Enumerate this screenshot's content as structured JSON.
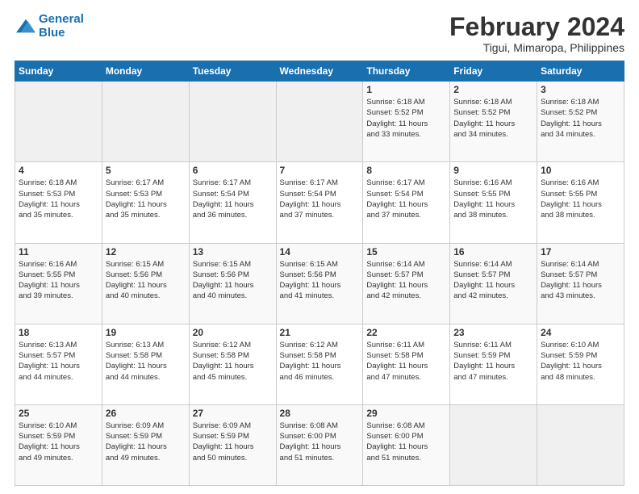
{
  "logo": {
    "line1": "General",
    "line2": "Blue"
  },
  "title": "February 2024",
  "subtitle": "Tigui, Mimaropa, Philippines",
  "days_header": [
    "Sunday",
    "Monday",
    "Tuesday",
    "Wednesday",
    "Thursday",
    "Friday",
    "Saturday"
  ],
  "weeks": [
    [
      {
        "num": "",
        "info": ""
      },
      {
        "num": "",
        "info": ""
      },
      {
        "num": "",
        "info": ""
      },
      {
        "num": "",
        "info": ""
      },
      {
        "num": "1",
        "info": "Sunrise: 6:18 AM\nSunset: 5:52 PM\nDaylight: 11 hours\nand 33 minutes."
      },
      {
        "num": "2",
        "info": "Sunrise: 6:18 AM\nSunset: 5:52 PM\nDaylight: 11 hours\nand 34 minutes."
      },
      {
        "num": "3",
        "info": "Sunrise: 6:18 AM\nSunset: 5:52 PM\nDaylight: 11 hours\nand 34 minutes."
      }
    ],
    [
      {
        "num": "4",
        "info": "Sunrise: 6:18 AM\nSunset: 5:53 PM\nDaylight: 11 hours\nand 35 minutes."
      },
      {
        "num": "5",
        "info": "Sunrise: 6:17 AM\nSunset: 5:53 PM\nDaylight: 11 hours\nand 35 minutes."
      },
      {
        "num": "6",
        "info": "Sunrise: 6:17 AM\nSunset: 5:54 PM\nDaylight: 11 hours\nand 36 minutes."
      },
      {
        "num": "7",
        "info": "Sunrise: 6:17 AM\nSunset: 5:54 PM\nDaylight: 11 hours\nand 37 minutes."
      },
      {
        "num": "8",
        "info": "Sunrise: 6:17 AM\nSunset: 5:54 PM\nDaylight: 11 hours\nand 37 minutes."
      },
      {
        "num": "9",
        "info": "Sunrise: 6:16 AM\nSunset: 5:55 PM\nDaylight: 11 hours\nand 38 minutes."
      },
      {
        "num": "10",
        "info": "Sunrise: 6:16 AM\nSunset: 5:55 PM\nDaylight: 11 hours\nand 38 minutes."
      }
    ],
    [
      {
        "num": "11",
        "info": "Sunrise: 6:16 AM\nSunset: 5:55 PM\nDaylight: 11 hours\nand 39 minutes."
      },
      {
        "num": "12",
        "info": "Sunrise: 6:15 AM\nSunset: 5:56 PM\nDaylight: 11 hours\nand 40 minutes."
      },
      {
        "num": "13",
        "info": "Sunrise: 6:15 AM\nSunset: 5:56 PM\nDaylight: 11 hours\nand 40 minutes."
      },
      {
        "num": "14",
        "info": "Sunrise: 6:15 AM\nSunset: 5:56 PM\nDaylight: 11 hours\nand 41 minutes."
      },
      {
        "num": "15",
        "info": "Sunrise: 6:14 AM\nSunset: 5:57 PM\nDaylight: 11 hours\nand 42 minutes."
      },
      {
        "num": "16",
        "info": "Sunrise: 6:14 AM\nSunset: 5:57 PM\nDaylight: 11 hours\nand 42 minutes."
      },
      {
        "num": "17",
        "info": "Sunrise: 6:14 AM\nSunset: 5:57 PM\nDaylight: 11 hours\nand 43 minutes."
      }
    ],
    [
      {
        "num": "18",
        "info": "Sunrise: 6:13 AM\nSunset: 5:57 PM\nDaylight: 11 hours\nand 44 minutes."
      },
      {
        "num": "19",
        "info": "Sunrise: 6:13 AM\nSunset: 5:58 PM\nDaylight: 11 hours\nand 44 minutes."
      },
      {
        "num": "20",
        "info": "Sunrise: 6:12 AM\nSunset: 5:58 PM\nDaylight: 11 hours\nand 45 minutes."
      },
      {
        "num": "21",
        "info": "Sunrise: 6:12 AM\nSunset: 5:58 PM\nDaylight: 11 hours\nand 46 minutes."
      },
      {
        "num": "22",
        "info": "Sunrise: 6:11 AM\nSunset: 5:58 PM\nDaylight: 11 hours\nand 47 minutes."
      },
      {
        "num": "23",
        "info": "Sunrise: 6:11 AM\nSunset: 5:59 PM\nDaylight: 11 hours\nand 47 minutes."
      },
      {
        "num": "24",
        "info": "Sunrise: 6:10 AM\nSunset: 5:59 PM\nDaylight: 11 hours\nand 48 minutes."
      }
    ],
    [
      {
        "num": "25",
        "info": "Sunrise: 6:10 AM\nSunset: 5:59 PM\nDaylight: 11 hours\nand 49 minutes."
      },
      {
        "num": "26",
        "info": "Sunrise: 6:09 AM\nSunset: 5:59 PM\nDaylight: 11 hours\nand 49 minutes."
      },
      {
        "num": "27",
        "info": "Sunrise: 6:09 AM\nSunset: 5:59 PM\nDaylight: 11 hours\nand 50 minutes."
      },
      {
        "num": "28",
        "info": "Sunrise: 6:08 AM\nSunset: 6:00 PM\nDaylight: 11 hours\nand 51 minutes."
      },
      {
        "num": "29",
        "info": "Sunrise: 6:08 AM\nSunset: 6:00 PM\nDaylight: 11 hours\nand 51 minutes."
      },
      {
        "num": "",
        "info": ""
      },
      {
        "num": "",
        "info": ""
      }
    ]
  ]
}
